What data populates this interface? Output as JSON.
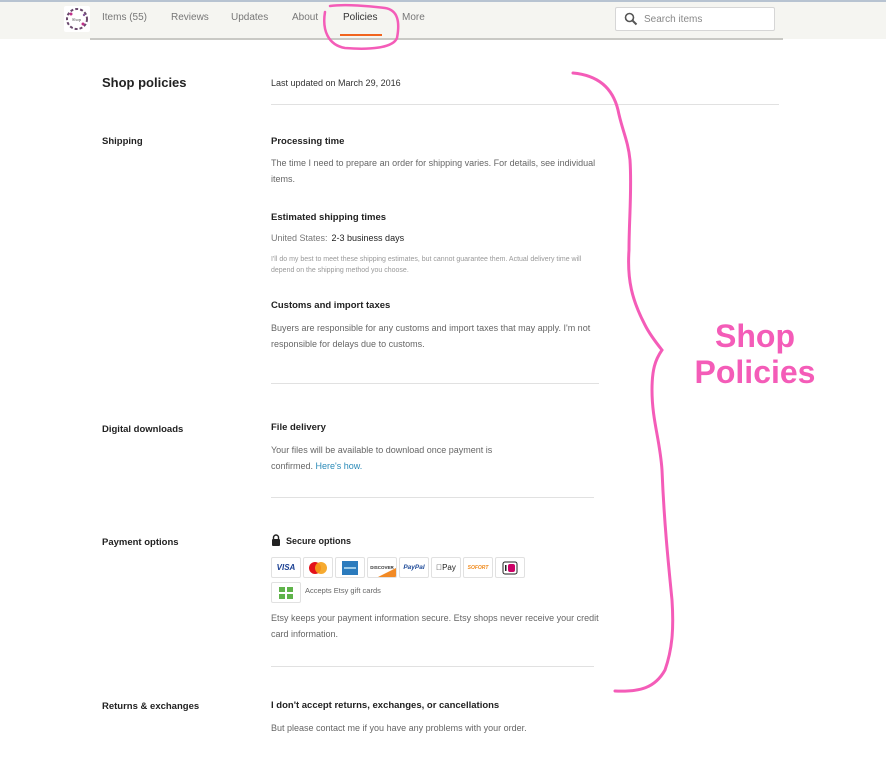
{
  "nav": {
    "items": [
      {
        "label": "Items (55)",
        "active": false
      },
      {
        "label": "Reviews",
        "active": false
      },
      {
        "label": "Updates",
        "active": false
      },
      {
        "label": "About",
        "active": false
      },
      {
        "label": "Policies",
        "active": true
      },
      {
        "label": "More",
        "active": false
      }
    ],
    "search_placeholder": "Search items",
    "accent_color": "#f1641e"
  },
  "page": {
    "title": "Shop policies",
    "last_updated": "Last updated on March 29, 2016"
  },
  "shipping": {
    "label": "Shipping",
    "processing_title": "Processing time",
    "processing_text": "The time I need to prepare an order for shipping varies. For details, see individual items.",
    "estimated_title": "Estimated shipping times",
    "country": "United States:",
    "estimate": "2-3 business days",
    "disclaimer": "I'll do my best to meet these shipping estimates, but cannot guarantee them. Actual delivery time will depend on the shipping method you choose.",
    "customs_title": "Customs and import taxes",
    "customs_text": "Buyers are responsible for any customs and import taxes that may apply. I'm not responsible for delays due to customs."
  },
  "digital": {
    "label": "Digital downloads",
    "title": "File delivery",
    "text": "Your files will be available to download once payment is confirmed.",
    "link": "Here's how."
  },
  "payment": {
    "label": "Payment options",
    "secure_title": "Secure options",
    "methods": [
      "VISA",
      "MasterCard",
      "American Express",
      "DISCOVER",
      "PayPal",
      "Pay",
      "SOFORT",
      "iDEAL"
    ],
    "gift_cards": "Accepts Etsy gift cards",
    "text": "Etsy keeps your payment information secure. Etsy shops never receive your credit card information."
  },
  "returns": {
    "label": "Returns & exchanges",
    "title": "I don't accept returns, exchanges, or cancellations",
    "text": "But please contact me if you have any problems with your order."
  },
  "annotation": {
    "text_line1": "Shop",
    "text_line2": "Policies",
    "color": "#f45cb8"
  }
}
